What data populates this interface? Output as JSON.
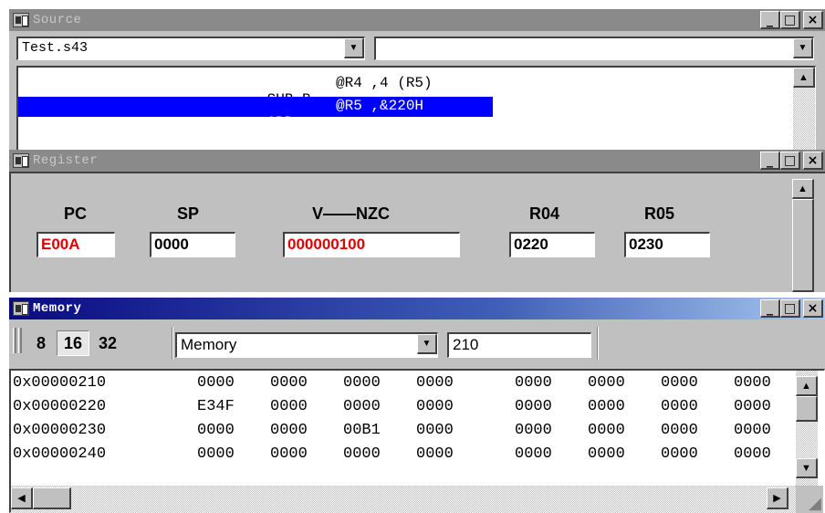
{
  "source": {
    "title": "Source",
    "file_combo_value": "Test.s43",
    "function_combo_value": "",
    "lines": [
      {
        "mnemonic": "SUB.B",
        "operands": "@R4 ,4 (R5)"
      },
      {
        "mnemonic": "ADD",
        "operands": "@R5 ,&220H"
      }
    ]
  },
  "register": {
    "title": "Register",
    "fields": [
      {
        "label": "PC",
        "value": "E00A"
      },
      {
        "label": "SP",
        "value": "0000"
      },
      {
        "label": "V——NZC",
        "value": "000000100"
      },
      {
        "label": "R04",
        "value": "0220"
      },
      {
        "label": "R05",
        "value": "0230"
      }
    ]
  },
  "memory": {
    "title": "Memory",
    "word_sizes": [
      "8",
      "16",
      "32"
    ],
    "selected_word_size": "16",
    "zone_value": "Memory",
    "address_value": "210",
    "rows": [
      {
        "address": "0x00000210",
        "words": [
          "0000",
          "0000",
          "0000",
          "0000",
          "0000",
          "0000",
          "0000",
          "0000"
        ]
      },
      {
        "address": "0x00000220",
        "words": [
          "E34F",
          "0000",
          "0000",
          "0000",
          "0000",
          "0000",
          "0000",
          "0000"
        ]
      },
      {
        "address": "0x00000230",
        "words": [
          "0000",
          "0000",
          "00B1",
          "0000",
          "0000",
          "0000",
          "0000",
          "0000"
        ]
      },
      {
        "address": "0x00000240",
        "words": [
          "0000",
          "0000",
          "0000",
          "0000",
          "0000",
          "0000",
          "0000",
          "0000"
        ]
      }
    ]
  },
  "title_buttons": {
    "minimize": "_",
    "maximize": "□",
    "close": "×"
  },
  "colors": {
    "highlight": "#0000ff",
    "register_value_red": "#e00000",
    "active_title": "#0a0a82",
    "inactive_title": "#8a8a8a"
  }
}
